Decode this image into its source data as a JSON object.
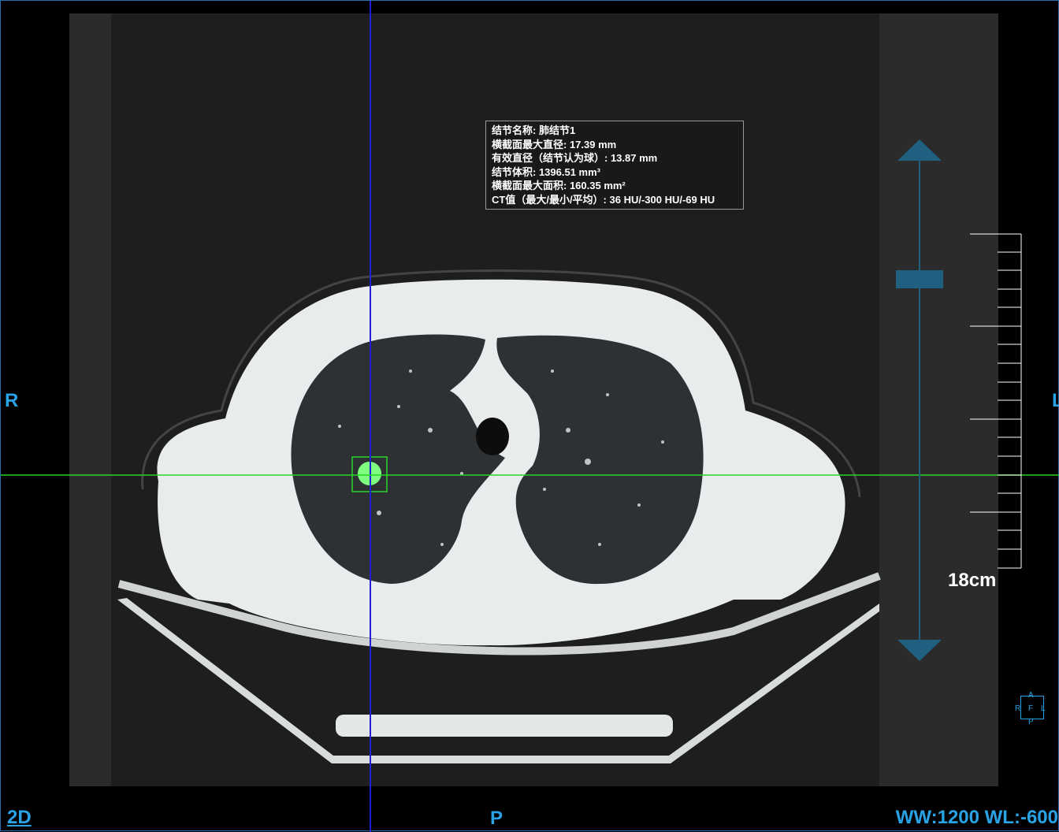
{
  "viewer": {
    "mode_label": "2D",
    "orientation": {
      "left": "R",
      "right": "L",
      "bottom": "P"
    },
    "window": "WW:1200 WL:-600",
    "scale_label": "18cm",
    "mini_orientation": {
      "top": "A",
      "left": "R",
      "center": "F",
      "right": "L",
      "bottom": "P"
    }
  },
  "nodule_info": {
    "name": "结节名称: 肺结节1",
    "max_diameter": "横截面最大直径:  17.39 mm",
    "effective_diameter": "有效直径（结节认为球）:  13.87 mm",
    "volume": "结节体积:  1396.51 mm³",
    "max_area": "横截面最大面积:  160.35 mm²",
    "ct_value": "CT值（最大/最小/平均）:  36 HU/-300 HU/-69 HU"
  },
  "colors": {
    "crosshair_vertical": "#1f1fd6",
    "crosshair_horizontal": "#27d627",
    "accent": "#29a3e6",
    "nodule": "#7fff7f",
    "slider": "#1f5f80"
  },
  "icons": {
    "slider_up": "triangle-up-icon",
    "slider_down": "triangle-down-icon"
  }
}
